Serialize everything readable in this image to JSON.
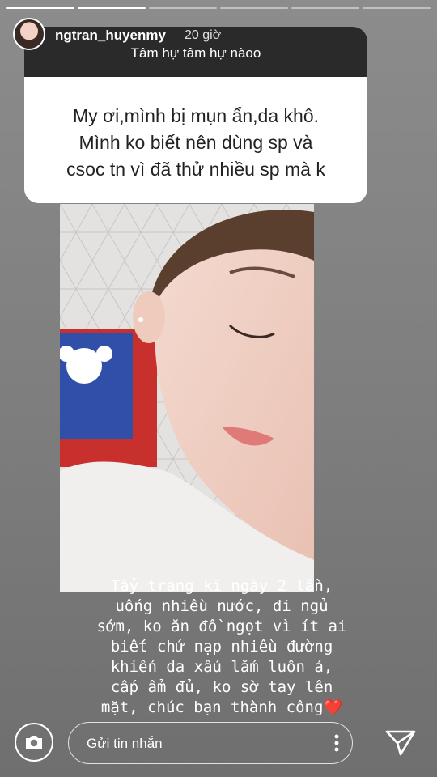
{
  "story": {
    "progress_segments": [
      1,
      1,
      0,
      0,
      0,
      0
    ]
  },
  "header": {
    "username": "ngtran_huyenmy",
    "time": "20 giờ"
  },
  "question": {
    "title": "Tâm hự tâm hự nàoo",
    "text": "My ơi,mình bị mụn ẩn,da khô.\nMình ko biết nên dùng sp và\ncsoc tn vì đã thử nhiều sp mà k"
  },
  "caption": {
    "text": "Tẩy trang kĩ ngày 2 lần,\nuống nhiều nước, đi ngủ\nsớm, ko ăn đồ ngọt vì ít ai\nbiết chứ nạp nhiều đường\nkhiến da xấu lắm luôn á,\ncấp ẩm đủ, ko sờ tay lên\nmặt, chúc bạn thành công",
    "emoji": "❤️"
  },
  "reply": {
    "placeholder": "Gửi tin nhắn"
  },
  "icons": {
    "camera": "camera-icon",
    "more": "more-vertical-icon",
    "send": "send-icon"
  }
}
